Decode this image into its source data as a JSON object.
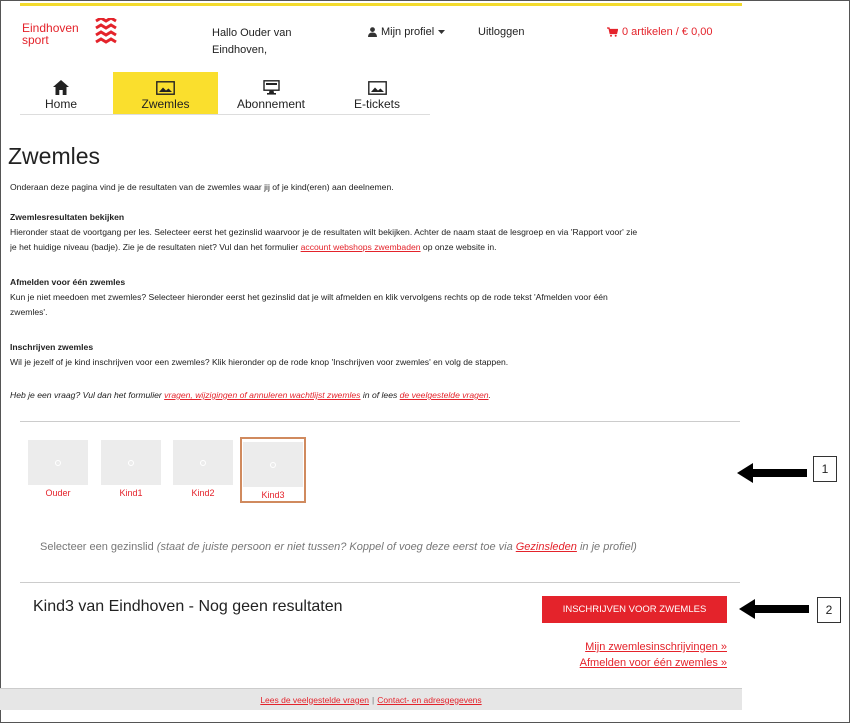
{
  "brand": {
    "name_line1": "Eindhoven",
    "name_line2": "sport",
    "color": "#e4232b",
    "icon": "eindhoven-logo-icon"
  },
  "header": {
    "greeting_line1": "Hallo Ouder van",
    "greeting_line2": "Eindhoven,",
    "profile_label": "Mijn profiel",
    "logout_label": "Uitloggen",
    "cart_label": "0 artikelen / € 0,00"
  },
  "nav": {
    "items": [
      {
        "label": "Home",
        "icon": "home-icon"
      },
      {
        "label": "Zwemles",
        "icon": "image-icon",
        "active": true
      },
      {
        "label": "Abonnement",
        "icon": "monitor-icon"
      },
      {
        "label": "E-tickets",
        "icon": "image-icon"
      }
    ],
    "active_color": "#fadf2d"
  },
  "page": {
    "title": "Zwemles",
    "intro": "Onderaan deze pagina vind je de resultaten van de zwemles waar jij of je kind(eren) aan deelnemen.",
    "results": {
      "heading": "Zwemlesresultaten bekijken",
      "line1": "Hieronder staat de voortgang per les. Selecteer eerst het gezinslid waarvoor je de resultaten wilt bekijken. Achter de naam staat de lesgroep en via 'Rapport voor' zie",
      "line2_pre": "je het huidige niveau (badje). Zie je de resultaten niet? Vul dan het formulier ",
      "line2_link": "account webshops zwembaden",
      "line2_post": " op onze website in."
    },
    "unsubscribe": {
      "heading": "Afmelden voor één zwemles",
      "line1": "Kun je niet meedoen met zwemles? Selecteer hieronder eerst het gezinslid dat je wilt afmelden en klik vervolgens rechts op de rode tekst 'Afmelden voor één",
      "line2": "zwemles'."
    },
    "enroll": {
      "heading": "Inschrijven zwemles",
      "line1": "Wil je jezelf of je kind inschrijven voor een zwemles? Klik hieronder op de rode knop 'Inschrijven voor zwemles' en volg de stappen."
    },
    "question": {
      "pre": "Heb je een vraag? Vul dan het formulier ",
      "link1": "vragen, wijzigingen of annuleren wachtlijst zwemles",
      "mid": " in of lees ",
      "link2": "de veelgestelde vragen",
      "post": "."
    }
  },
  "members": {
    "items": [
      {
        "label": "Ouder"
      },
      {
        "label": "Kind1"
      },
      {
        "label": "Kind2"
      },
      {
        "label": "Kind3",
        "selected": true
      }
    ],
    "hint_pre": "Selecteer een gezinslid ",
    "hint_italic_pre": "(staat de juiste persoon er niet tussen? Koppel of voeg deze eerst toe via ",
    "hint_link": "Gezinsleden",
    "hint_italic_post": " in je profiel)"
  },
  "callouts": {
    "first": "1",
    "second": "2"
  },
  "result": {
    "title": "Kind3 van Eindhoven - Nog geen resultaten",
    "enroll_button": "INSCHRIJVEN VOOR ZWEMLES",
    "link_my_enrollments": "Mijn zwemlesinschrijvingen »",
    "link_unsubscribe": "Afmelden voor één zwemles »"
  },
  "footer": {
    "link_faq": "Lees de veelgestelde vragen",
    "separator": "|",
    "link_contact": "Contact- en adresgegevens"
  }
}
